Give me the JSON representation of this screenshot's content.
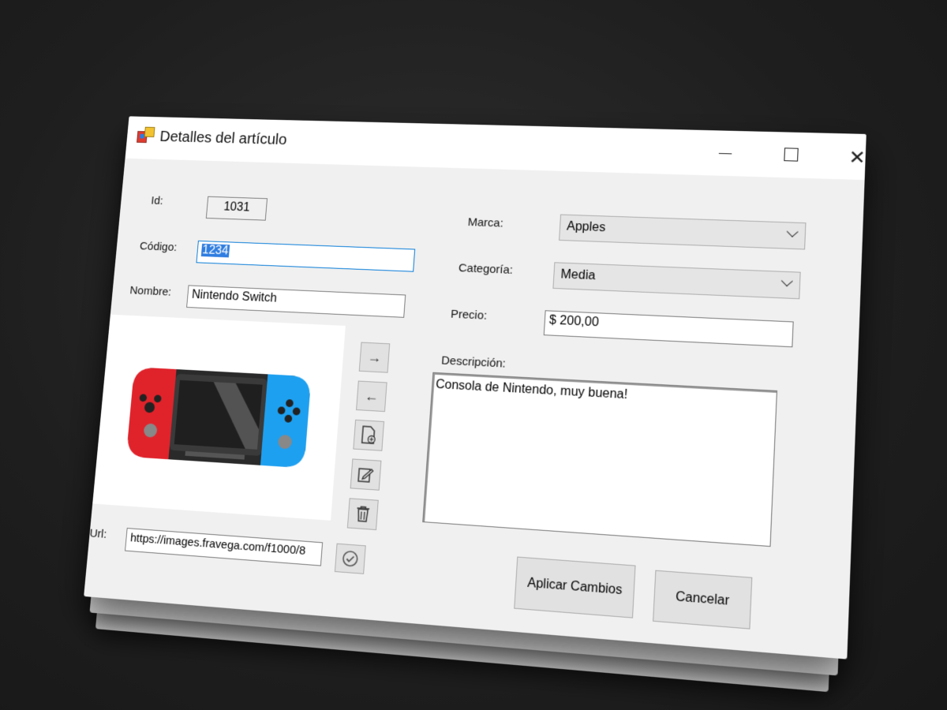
{
  "window": {
    "title": "Detalles del artículo",
    "controls": {
      "minimize": "minimize-icon",
      "maximize": "maximize-icon",
      "close": "close-icon"
    }
  },
  "form": {
    "id": {
      "label": "Id:",
      "value": "1031"
    },
    "codigo": {
      "label": "Código:",
      "value": "1234"
    },
    "nombre": {
      "label": "Nombre:",
      "value": "Nintendo Switch"
    },
    "marca": {
      "label": "Marca:",
      "selected": "Apples"
    },
    "categoria": {
      "label": "Categoría:",
      "selected": "Media"
    },
    "precio": {
      "label": "Precio:",
      "value": "$ 200,00"
    },
    "descripcion": {
      "label": "Descripción:",
      "value": "Consola de Nintendo, muy buena!"
    },
    "url": {
      "label": "Url:",
      "value": "https://images.fravega.com/f1000/8"
    }
  },
  "image_tools": {
    "next": "→",
    "prev": "←",
    "add_icon": "file-add-icon",
    "edit_icon": "pencil-icon",
    "delete_icon": "trash-icon",
    "check_icon": "check-circle-icon"
  },
  "buttons": {
    "apply": "Aplicar Cambios",
    "cancel": "Cancelar"
  },
  "colors": {
    "focus_border": "#0078d7",
    "selection": "#2f7de0",
    "console_red": "#e0232b",
    "console_blue": "#1ea0f0"
  }
}
